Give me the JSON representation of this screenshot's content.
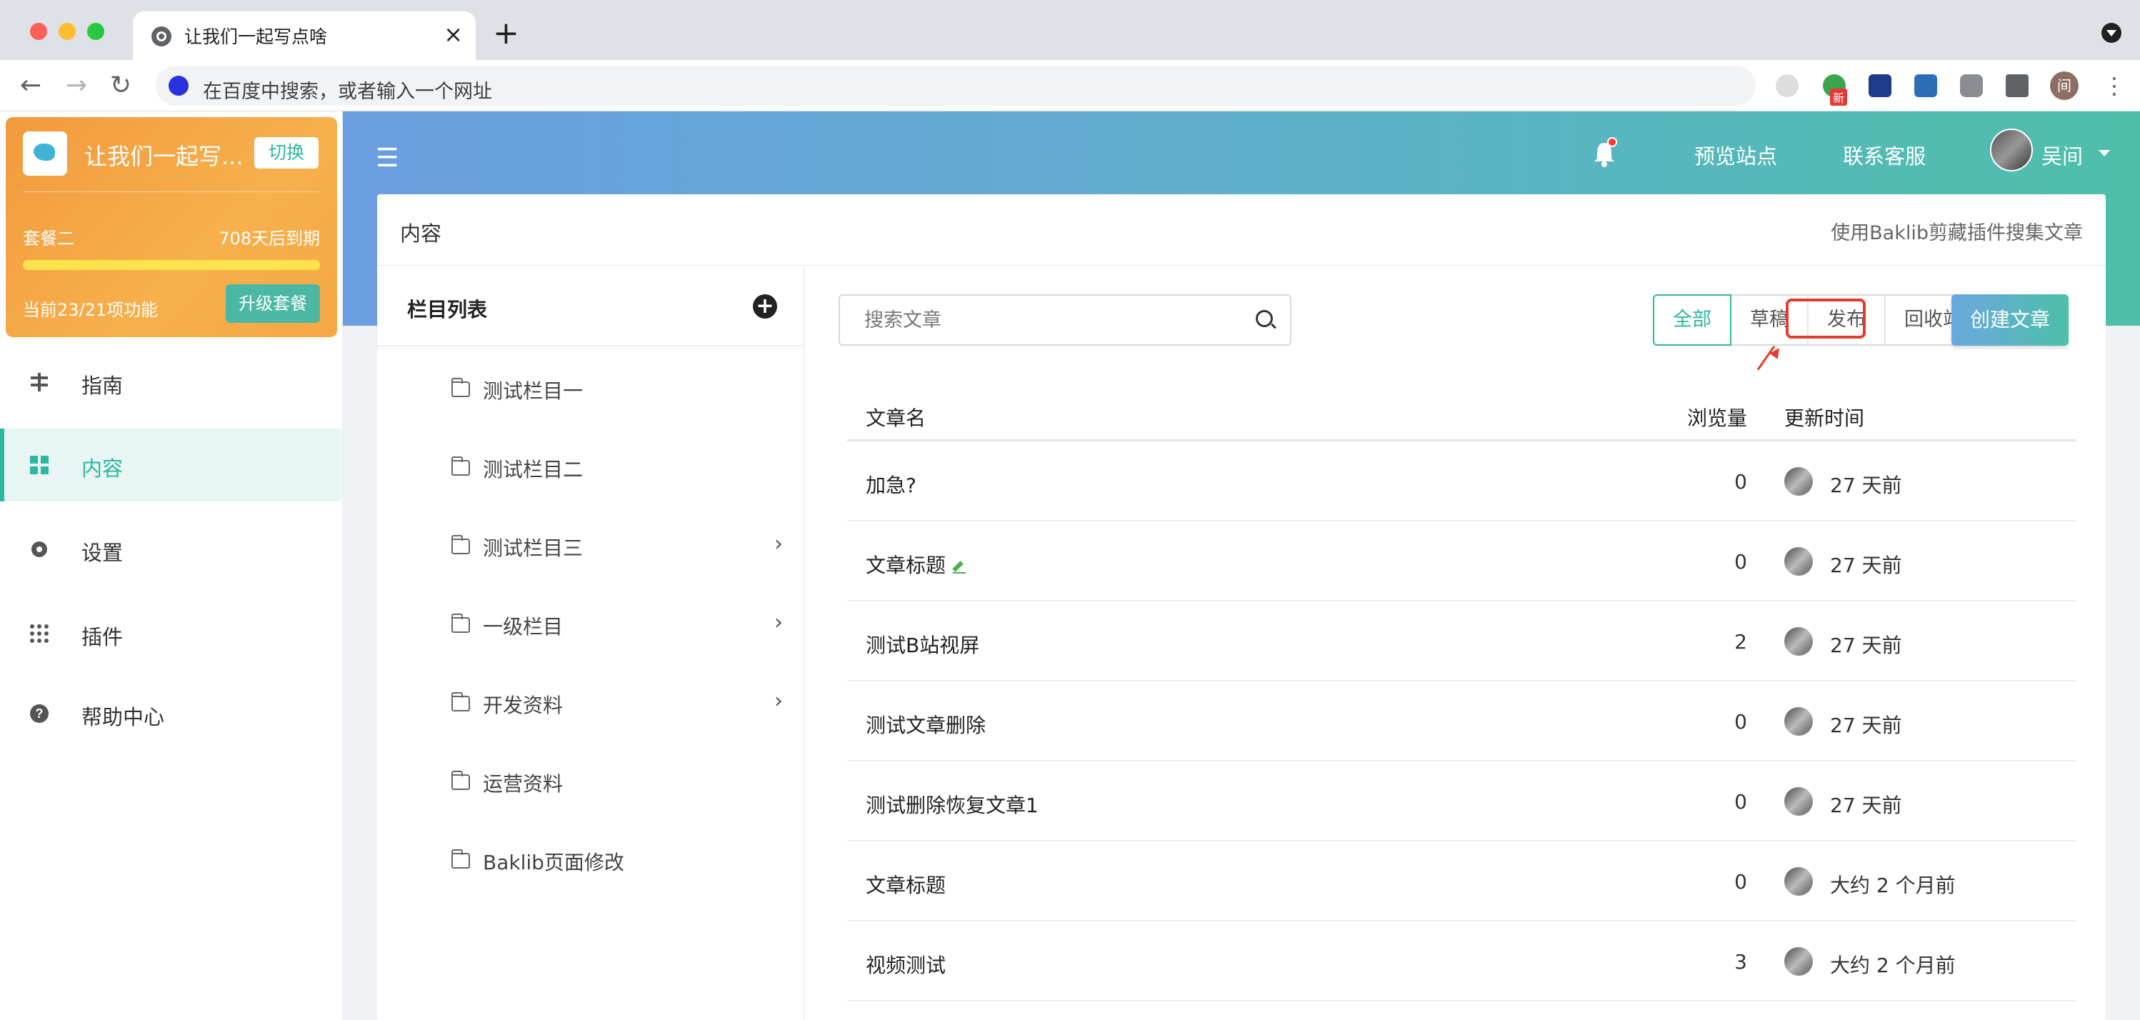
{
  "browser": {
    "tab_title": "让我们一起写点啥",
    "tab_close": "×",
    "new_tab": "+",
    "address_placeholder": "在百度中搜索，或者输入一个网址",
    "ext_badge": "新",
    "profile_initial": "间",
    "back": "←",
    "forward": "→",
    "reload": "↻",
    "kebab": "⋮"
  },
  "sidebar": {
    "site_name": "让我们一起写...",
    "switch_label": "切换",
    "plan_name": "套餐二",
    "plan_expire": "708天后到期",
    "plan_usage": "当前23/21项功能",
    "plan_progress": 1.0,
    "upgrade_label": "升级套餐",
    "items": [
      {
        "label": "指南",
        "icon": "signpost-icon"
      },
      {
        "label": "内容",
        "icon": "grid-icon",
        "active": true
      },
      {
        "label": "设置",
        "icon": "gear-icon"
      },
      {
        "label": "插件",
        "icon": "dots-grid-icon"
      },
      {
        "label": "帮助中心",
        "icon": "help-icon"
      }
    ]
  },
  "header": {
    "menu_icon": "☰",
    "preview_label": "预览站点",
    "support_label": "联系客服",
    "user_name": "吴间"
  },
  "content": {
    "title": "内容",
    "hint": "使用Baklib剪藏插件搜集文章",
    "columns_title": "栏目列表",
    "columns": [
      {
        "label": "测试栏目一",
        "has_children": false
      },
      {
        "label": "测试栏目二",
        "has_children": false
      },
      {
        "label": "测试栏目三",
        "has_children": true
      },
      {
        "label": "一级栏目",
        "has_children": true
      },
      {
        "label": "开发资料",
        "has_children": true
      },
      {
        "label": "运营资料",
        "has_children": false
      },
      {
        "label": "Baklib页面修改",
        "has_children": false
      }
    ],
    "search_placeholder": "搜索文章",
    "filters": [
      "全部",
      "草稿",
      "发布",
      "回收站"
    ],
    "active_filter": "全部",
    "create_label": "创建文章",
    "table_headers": {
      "title": "文章名",
      "views": "浏览量",
      "updated": "更新时间"
    },
    "articles": [
      {
        "title": "加急?",
        "views": "0",
        "updated": "27 天前",
        "edit_mark": false
      },
      {
        "title": "文章标题",
        "views": "0",
        "updated": "27 天前",
        "edit_mark": true
      },
      {
        "title": "测试B站视屏",
        "views": "2",
        "updated": "27 天前",
        "edit_mark": false
      },
      {
        "title": "测试文章删除",
        "views": "0",
        "updated": "27 天前",
        "edit_mark": false
      },
      {
        "title": "测试删除恢复文章1",
        "views": "0",
        "updated": "27 天前",
        "edit_mark": false
      },
      {
        "title": "文章标题",
        "views": "0",
        "updated": "大约 2 个月前",
        "edit_mark": false
      },
      {
        "title": "视频测试",
        "views": "3",
        "updated": "大约 2 个月前",
        "edit_mark": false
      }
    ]
  },
  "colors": {
    "accent": "#2db7a0",
    "highlight_red": "#e33b2e",
    "plan_card": "#f19a3e"
  }
}
